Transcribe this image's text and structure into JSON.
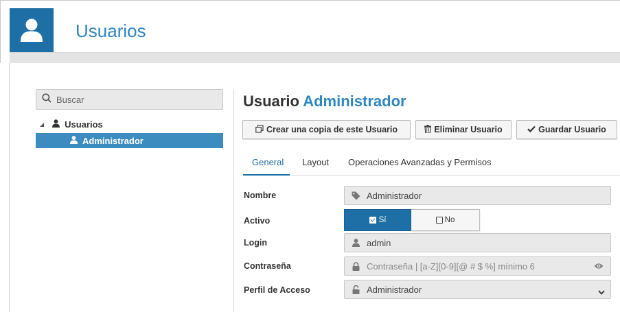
{
  "header": {
    "title": "Usuarios"
  },
  "sidebar": {
    "search_placeholder": "Buscar",
    "tree": {
      "root_label": "Usuarios",
      "children": [
        {
          "label": "Administrador",
          "selected": true
        }
      ]
    }
  },
  "main": {
    "title_prefix": "Usuario",
    "title_name": "Administrador",
    "toolbar": {
      "copy_label": "Crear una copia de este Usuario",
      "delete_label": "Eliminar Usuario",
      "save_label": "Guardar Usuario"
    },
    "tabs": [
      {
        "label": "General",
        "active": true
      },
      {
        "label": "Layout",
        "active": false
      },
      {
        "label": "Operaciones Avanzadas y Permisos",
        "active": false
      }
    ],
    "form": {
      "nombre_label": "Nombre",
      "nombre_value": "Administrador",
      "activo_label": "Activo",
      "activo_yes": "Sí",
      "activo_no": "No",
      "activo_selected": "Sí",
      "login_label": "Login",
      "login_value": "admin",
      "password_label": "Contraseña",
      "password_placeholder": "Contraseña | [a-Z][0-9][@ # $ %] mínimo 6",
      "perfil_label": "Perfil de Acceso",
      "perfil_value": "Administrador"
    }
  },
  "colors": {
    "brand": "#1e6fa5",
    "accent_text": "#2e86c1",
    "selection": "#3c8cbf"
  },
  "icons": [
    "user-icon",
    "search-icon",
    "copy-icon",
    "trash-icon",
    "check-icon",
    "tag-icon",
    "lock-icon",
    "unlock-icon",
    "eye-icon",
    "chevron-down-icon",
    "caret-down-icon"
  ]
}
